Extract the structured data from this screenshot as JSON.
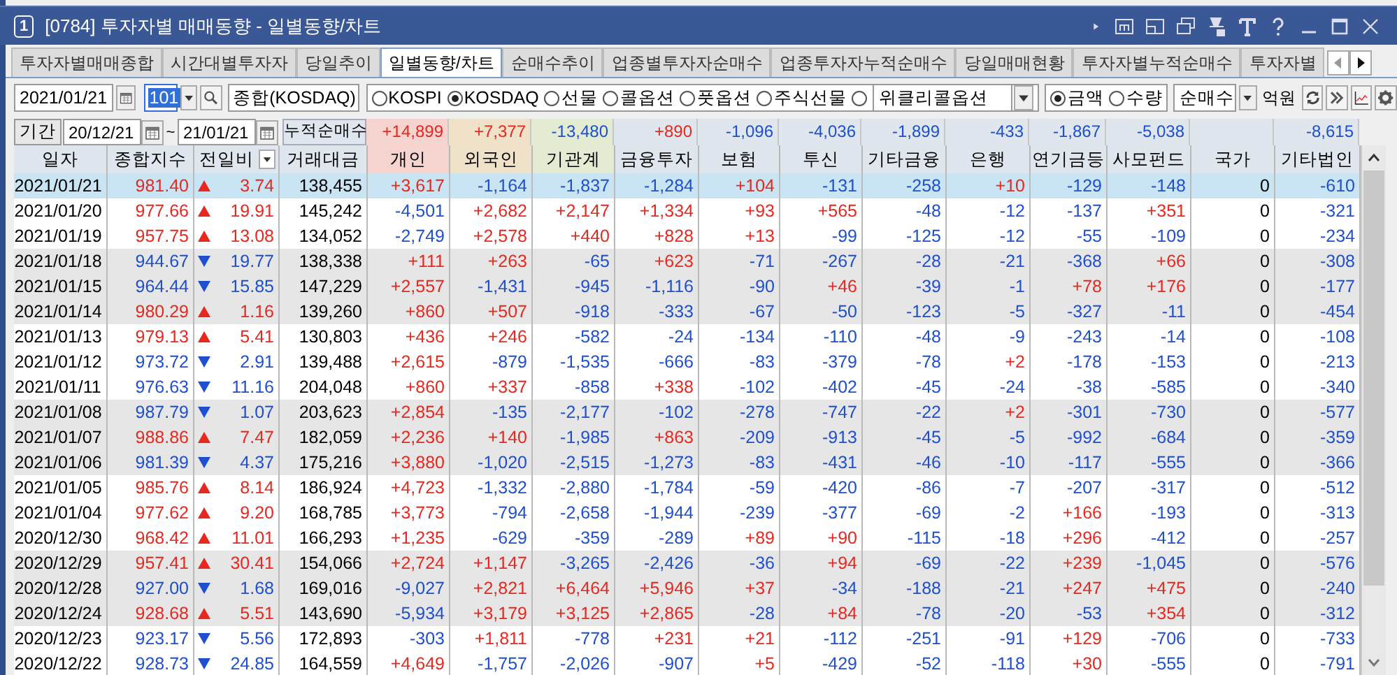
{
  "window": {
    "badge": "1",
    "title": "[0784] 투자자별 매매동향 - 일별동향/차트"
  },
  "tabs": [
    {
      "label": "투자자별매매종합",
      "selected": false
    },
    {
      "label": "시간대별투자자",
      "selected": false
    },
    {
      "label": "당일추이",
      "selected": false
    },
    {
      "label": "일별동향/차트",
      "selected": true
    },
    {
      "label": "순매수추이",
      "selected": false
    },
    {
      "label": "업종별투자자순매수",
      "selected": false
    },
    {
      "label": "업종투자자누적순매수",
      "selected": false
    },
    {
      "label": "당일매매현황",
      "selected": false
    },
    {
      "label": "투자자별누적순매수",
      "selected": false
    },
    {
      "label": "투자자별",
      "selected": false
    }
  ],
  "controls": {
    "date": "2021/01/21",
    "code": "101",
    "market_name": "종합(KOSDAQ)",
    "markets": [
      {
        "label": "KOSPI",
        "selected": false
      },
      {
        "label": "KOSDAQ",
        "selected": true
      },
      {
        "label": "선물",
        "selected": false
      },
      {
        "label": "콜옵션",
        "selected": false
      },
      {
        "label": "풋옵션",
        "selected": false
      },
      {
        "label": "주식선물",
        "selected": false
      },
      {
        "label": "위클리콜옵션",
        "selected": false,
        "kind": "dropdown"
      }
    ],
    "units": [
      {
        "label": "금액",
        "selected": true
      },
      {
        "label": "수량",
        "selected": false
      }
    ],
    "mode": "순매수",
    "unit_label": "억원"
  },
  "period": {
    "button": "기간",
    "from": "20/12/21",
    "separator": "~",
    "to": "21/01/21",
    "totals_label": "누적순매수"
  },
  "table": {
    "columns": [
      {
        "label": "일자",
        "color": "#dfe6ee"
      },
      {
        "label": "종합지수",
        "color": "#dfe6ee"
      },
      {
        "label": "전일비",
        "color": "#dfe6ee"
      },
      {
        "label": "거래대금",
        "color": "#dfe6ee"
      },
      {
        "label": "개인",
        "color": "#f5d3ce",
        "total": "+14,899"
      },
      {
        "label": "외국인",
        "color": "#efe2c9",
        "total": "+7,377"
      },
      {
        "label": "기관계",
        "color": "#e3ecd3",
        "total": "-13,480"
      },
      {
        "label": "금융투자",
        "color": "#dfe6ee",
        "total": "+890"
      },
      {
        "label": "보험",
        "color": "#dfe6ee",
        "total": "-1,096"
      },
      {
        "label": "투신",
        "color": "#dfe6ee",
        "total": "-4,036"
      },
      {
        "label": "기타금융",
        "color": "#dfe6ee",
        "total": "-1,899"
      },
      {
        "label": "은행",
        "color": "#dfe6ee",
        "total": "-433"
      },
      {
        "label": "연기금등",
        "color": "#dfe6ee",
        "total": "-1,867"
      },
      {
        "label": "사모펀드",
        "color": "#dfe6ee",
        "total": "-5,038"
      },
      {
        "label": "국가",
        "color": "#dfe6ee"
      },
      {
        "label": "기타법인",
        "color": "#dfe6ee",
        "total": "-8,615"
      }
    ],
    "rows": [
      {
        "date": "2021/01/21",
        "index": "981.40",
        "rising": true,
        "change": "3.74",
        "amount": "138,455",
        "values": [
          "+3,617",
          "-1,164",
          "-1,837",
          "-1,284",
          "+104",
          "-131",
          "-258",
          "+10",
          "-129",
          "-148",
          "0",
          "-610"
        ],
        "selected": true,
        "shaded": false
      },
      {
        "date": "2021/01/20",
        "index": "977.66",
        "rising": true,
        "change": "19.91",
        "amount": "145,242",
        "values": [
          "-4,501",
          "+2,682",
          "+2,147",
          "+1,334",
          "+93",
          "+565",
          "-48",
          "-12",
          "-137",
          "+351",
          "0",
          "-321"
        ],
        "selected": false,
        "shaded": false
      },
      {
        "date": "2021/01/19",
        "index": "957.75",
        "rising": true,
        "change": "13.08",
        "amount": "134,052",
        "values": [
          "-2,749",
          "+2,578",
          "+440",
          "+828",
          "+13",
          "-99",
          "-125",
          "-12",
          "-55",
          "-109",
          "0",
          "-234"
        ],
        "selected": false,
        "shaded": false
      },
      {
        "date": "2021/01/18",
        "index": "944.67",
        "rising": false,
        "change": "19.77",
        "amount": "138,338",
        "values": [
          "+111",
          "+263",
          "-65",
          "+623",
          "-71",
          "-267",
          "-28",
          "-21",
          "-368",
          "+66",
          "0",
          "-308"
        ],
        "selected": false,
        "shaded": true
      },
      {
        "date": "2021/01/15",
        "index": "964.44",
        "rising": false,
        "change": "15.85",
        "amount": "147,229",
        "values": [
          "+2,557",
          "-1,431",
          "-945",
          "-1,116",
          "-90",
          "+46",
          "-39",
          "-1",
          "+78",
          "+176",
          "0",
          "-177"
        ],
        "selected": false,
        "shaded": true
      },
      {
        "date": "2021/01/14",
        "index": "980.29",
        "rising": true,
        "change": "1.16",
        "amount": "139,260",
        "values": [
          "+860",
          "+507",
          "-918",
          "-333",
          "-67",
          "-50",
          "-123",
          "-5",
          "-327",
          "-11",
          "0",
          "-454"
        ],
        "selected": false,
        "shaded": true
      },
      {
        "date": "2021/01/13",
        "index": "979.13",
        "rising": true,
        "change": "5.41",
        "amount": "130,803",
        "values": [
          "+436",
          "+246",
          "-582",
          "-24",
          "-134",
          "-110",
          "-48",
          "-9",
          "-243",
          "-14",
          "0",
          "-108"
        ],
        "selected": false,
        "shaded": false
      },
      {
        "date": "2021/01/12",
        "index": "973.72",
        "rising": false,
        "change": "2.91",
        "amount": "139,488",
        "values": [
          "+2,615",
          "-879",
          "-1,535",
          "-666",
          "-83",
          "-379",
          "-78",
          "+2",
          "-178",
          "-153",
          "0",
          "-213"
        ],
        "selected": false,
        "shaded": false
      },
      {
        "date": "2021/01/11",
        "index": "976.63",
        "rising": false,
        "change": "11.16",
        "amount": "204,048",
        "values": [
          "+860",
          "+337",
          "-858",
          "+338",
          "-102",
          "-402",
          "-45",
          "-24",
          "-38",
          "-585",
          "0",
          "-340"
        ],
        "selected": false,
        "shaded": false
      },
      {
        "date": "2021/01/08",
        "index": "987.79",
        "rising": false,
        "change": "1.07",
        "amount": "203,623",
        "values": [
          "+2,854",
          "-135",
          "-2,177",
          "-102",
          "-278",
          "-747",
          "-22",
          "+2",
          "-301",
          "-730",
          "0",
          "-577"
        ],
        "selected": false,
        "shaded": true
      },
      {
        "date": "2021/01/07",
        "index": "988.86",
        "rising": true,
        "change": "7.47",
        "amount": "182,059",
        "values": [
          "+2,236",
          "+140",
          "-1,985",
          "+863",
          "-209",
          "-913",
          "-45",
          "-5",
          "-992",
          "-684",
          "0",
          "-359"
        ],
        "selected": false,
        "shaded": true
      },
      {
        "date": "2021/01/06",
        "index": "981.39",
        "rising": false,
        "change": "4.37",
        "amount": "175,216",
        "values": [
          "+3,880",
          "-1,020",
          "-2,515",
          "-1,273",
          "-83",
          "-431",
          "-46",
          "-10",
          "-117",
          "-555",
          "0",
          "-366"
        ],
        "selected": false,
        "shaded": true
      },
      {
        "date": "2021/01/05",
        "index": "985.76",
        "rising": true,
        "change": "8.14",
        "amount": "186,924",
        "values": [
          "+4,723",
          "-1,332",
          "-2,880",
          "-1,784",
          "-59",
          "-420",
          "-86",
          "-7",
          "-207",
          "-317",
          "0",
          "-512"
        ],
        "selected": false,
        "shaded": false
      },
      {
        "date": "2021/01/04",
        "index": "977.62",
        "rising": true,
        "change": "9.20",
        "amount": "168,785",
        "values": [
          "+3,773",
          "-794",
          "-2,658",
          "-1,944",
          "-239",
          "-377",
          "-69",
          "-2",
          "+166",
          "-193",
          "0",
          "-313"
        ],
        "selected": false,
        "shaded": false
      },
      {
        "date": "2020/12/30",
        "index": "968.42",
        "rising": true,
        "change": "11.01",
        "amount": "166,293",
        "values": [
          "+1,235",
          "-629",
          "-359",
          "-289",
          "+89",
          "+90",
          "-115",
          "-18",
          "+296",
          "-412",
          "0",
          "-257"
        ],
        "selected": false,
        "shaded": false
      },
      {
        "date": "2020/12/29",
        "index": "957.41",
        "rising": true,
        "change": "30.41",
        "amount": "154,066",
        "values": [
          "+2,724",
          "+1,147",
          "-3,265",
          "-2,426",
          "-36",
          "+94",
          "-69",
          "-22",
          "+239",
          "-1,045",
          "0",
          "-576"
        ],
        "selected": false,
        "shaded": true
      },
      {
        "date": "2020/12/28",
        "index": "927.00",
        "rising": false,
        "change": "1.68",
        "amount": "169,016",
        "values": [
          "-9,027",
          "+2,821",
          "+6,464",
          "+5,946",
          "+37",
          "-34",
          "-188",
          "-21",
          "+247",
          "+475",
          "0",
          "-240"
        ],
        "selected": false,
        "shaded": true
      },
      {
        "date": "2020/12/24",
        "index": "928.68",
        "rising": true,
        "change": "5.51",
        "amount": "143,690",
        "values": [
          "-5,934",
          "+3,179",
          "+3,125",
          "+2,865",
          "-28",
          "+84",
          "-78",
          "-20",
          "-53",
          "+354",
          "0",
          "-312"
        ],
        "selected": false,
        "shaded": true
      },
      {
        "date": "2020/12/23",
        "index": "923.17",
        "rising": false,
        "change": "5.56",
        "amount": "172,893",
        "values": [
          "-303",
          "+1,811",
          "-778",
          "+231",
          "+21",
          "-112",
          "-251",
          "-91",
          "+129",
          "-706",
          "0",
          "-733"
        ],
        "selected": false,
        "shaded": false
      },
      {
        "date": "2020/12/22",
        "index": "928.73",
        "rising": false,
        "change": "24.85",
        "amount": "164,559",
        "values": [
          "+4,649",
          "-1,757",
          "-2,026",
          "-907",
          "+5",
          "-429",
          "-52",
          "-118",
          "+30",
          "-555",
          "0",
          "-791"
        ],
        "selected": false,
        "shaded": false
      }
    ]
  }
}
